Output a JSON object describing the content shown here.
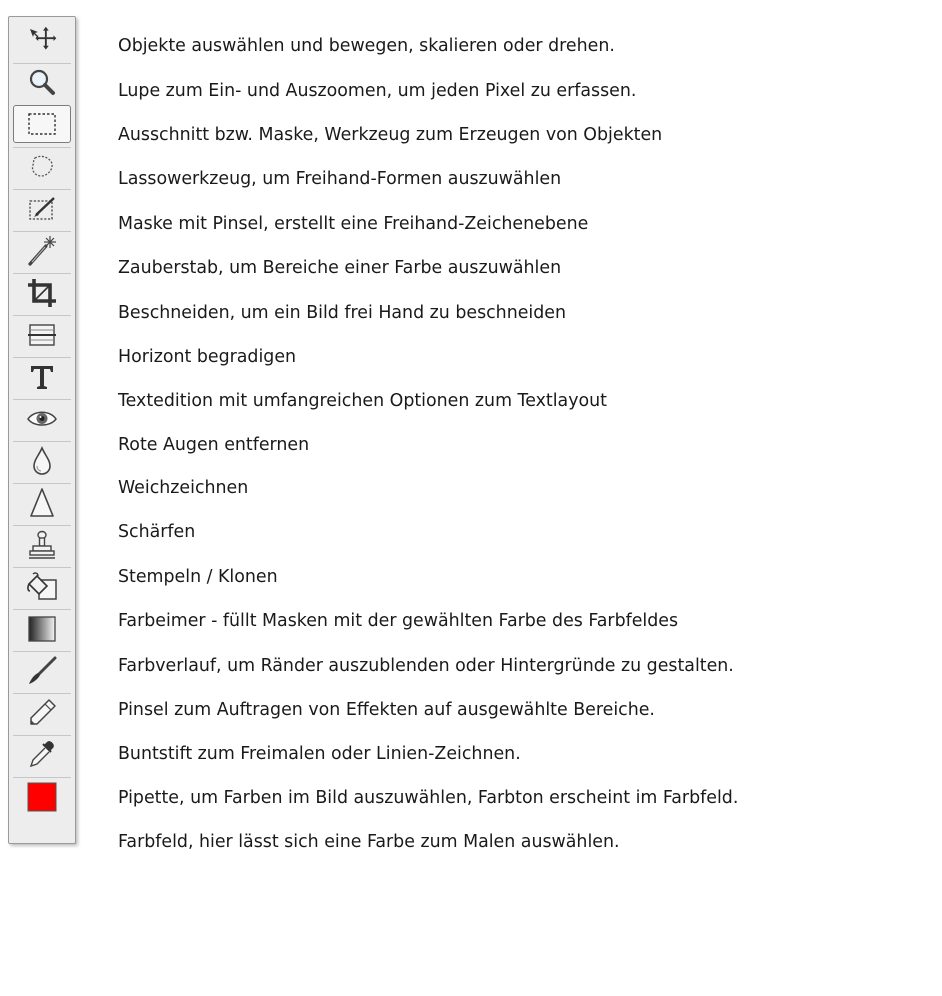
{
  "tools": [
    {
      "icon": "move-select-icon",
      "description": "Objekte auswählen und bewegen, skalieren oder drehen."
    },
    {
      "icon": "magnifier-icon",
      "description": "Lupe zum Ein- und Auszoomen, um jeden Pixel zu erfassen."
    },
    {
      "icon": "marquee-selection-icon",
      "description": "Ausschnitt bzw. Maske, Werkzeug zum Erzeugen von Objekten"
    },
    {
      "icon": "lasso-icon",
      "description": "Lassowerkzeug, um Freihand-Formen auszuwählen"
    },
    {
      "icon": "brush-mask-icon",
      "description": "Maske mit Pinsel, erstellt eine Freihand-Zeichenebene"
    },
    {
      "icon": "magic-wand-icon",
      "description": "Zauberstab, um Bereiche einer Farbe auszuwählen"
    },
    {
      "icon": "crop-icon",
      "description": "Beschneiden, um ein Bild frei Hand zu beschneiden"
    },
    {
      "icon": "straighten-icon",
      "description": "Horizont begradigen"
    },
    {
      "icon": "text-icon",
      "description": "Textedition mit umfangreichen Optionen zum Textlayout"
    },
    {
      "icon": "red-eye-icon",
      "description": "Rote Augen entfernen"
    },
    {
      "icon": "blur-drop-icon",
      "description": "Weichzeichnen"
    },
    {
      "icon": "sharpen-icon",
      "description": "Schärfen"
    },
    {
      "icon": "clone-stamp-icon",
      "description": "Stempeln / Klonen"
    },
    {
      "icon": "paint-bucket-icon",
      "description": "Farbeimer - füllt Masken mit der gewählten Farbe des Farbfeldes"
    },
    {
      "icon": "gradient-icon",
      "description": "Farbverlauf, um Ränder auszublenden oder Hintergründe zu gestalten."
    },
    {
      "icon": "paintbrush-icon",
      "description": "Pinsel zum Auftragen von Effekten auf ausgewählte Bereiche."
    },
    {
      "icon": "pencil-icon",
      "description": "Buntstift zum Freimalen oder Linien-Zeichnen."
    },
    {
      "icon": "eyedropper-icon",
      "description": "Pipette, um Farben im Bild auszuwählen, Farbton erscheint im Farbfeld."
    },
    {
      "icon": "color-swatch-icon",
      "description": "Farbfeld, hier lässt sich eine Farbe zum Malen auswählen."
    }
  ],
  "colors": {
    "swatch": "#ff0000",
    "toolbar_bg": "#ededed"
  }
}
